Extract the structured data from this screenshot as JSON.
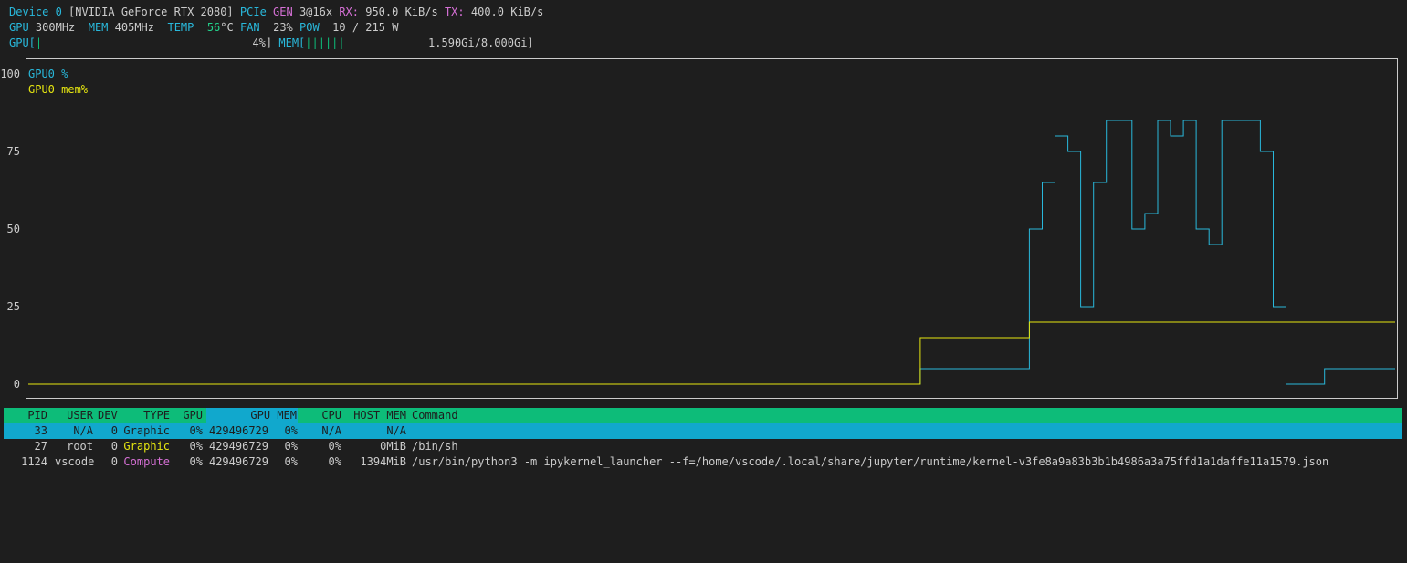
{
  "status": {
    "device_label": "Device 0",
    "device_name": "[NVIDIA GeForce RTX 2080]",
    "pcie_label": "PCIe",
    "gen_label": "GEN",
    "gen_value": "3@16x",
    "rx_label": "RX:",
    "rx_value": "950.0 KiB/s",
    "tx_label": "TX:",
    "tx_value": "400.0 KiB/s",
    "gpu_label": "GPU",
    "gpu_clock": "300MHz",
    "mem_label": "MEM",
    "mem_clock": "405MHz",
    "temp_label": "TEMP",
    "temp_value": "56",
    "temp_unit": "°C",
    "fan_label": "FAN",
    "fan_value": "23%",
    "pow_label": "POW",
    "pow_value": "10 / 215 W",
    "gpu_bar_label": "GPU[",
    "gpu_bar_fill": "|",
    "gpu_bar_value": "4%]",
    "mem_bar_label": "MEM[",
    "mem_bar_fill": "||||||",
    "mem_bar_value": "1.590Gi/8.000Gi]"
  },
  "chart_data": {
    "type": "line",
    "ylim": [
      0,
      100
    ],
    "yticks": [
      "100",
      "75",
      "50",
      "25",
      "0"
    ],
    "legend": [
      "GPU0 %",
      "GPU0 mem%"
    ],
    "colors": {
      "gpu": "#29b8db",
      "mem": "#e5e510"
    },
    "series": [
      {
        "name": "GPU0 %",
        "values": [
          0,
          0,
          0,
          0,
          0,
          0,
          0,
          0,
          0,
          0,
          0,
          0,
          0,
          0,
          0,
          0,
          0,
          0,
          0,
          0,
          0,
          0,
          0,
          0,
          0,
          0,
          0,
          0,
          0,
          0,
          0,
          0,
          0,
          0,
          0,
          0,
          0,
          0,
          0,
          0,
          0,
          0,
          0,
          0,
          0,
          0,
          0,
          0,
          0,
          0,
          0,
          0,
          0,
          0,
          0,
          0,
          0,
          0,
          0,
          0,
          0,
          0,
          0,
          0,
          0,
          0,
          0,
          0,
          0,
          0,
          0,
          0,
          0,
          0,
          0,
          0,
          0,
          0,
          0,
          0,
          0,
          0,
          0,
          0,
          0,
          0,
          0,
          0,
          0,
          0,
          0,
          0,
          0,
          0,
          0,
          0,
          0,
          0,
          0,
          0,
          0,
          0,
          0,
          0,
          0,
          0,
          0,
          0,
          0,
          0,
          0,
          0,
          0,
          0,
          0,
          0,
          0,
          0,
          0,
          0,
          0,
          0,
          0,
          0,
          0,
          0,
          0,
          0,
          0,
          0,
          0,
          0,
          0,
          0,
          0,
          0,
          0,
          0,
          0,
          5,
          5,
          5,
          5,
          5,
          5,
          5,
          5,
          5,
          5,
          5,
          5,
          5,
          5,
          5,
          5,
          5,
          50,
          50,
          65,
          65,
          80,
          80,
          75,
          75,
          25,
          25,
          65,
          65,
          85,
          85,
          85,
          85,
          50,
          50,
          55,
          55,
          85,
          85,
          80,
          80,
          85,
          85,
          50,
          50,
          45,
          45,
          85,
          85,
          85,
          85,
          85,
          85,
          75,
          75,
          25,
          25,
          0,
          0,
          0,
          0,
          0,
          0,
          5,
          5,
          5,
          5,
          5,
          5,
          5,
          5,
          5,
          5,
          5
        ]
      },
      {
        "name": "GPU0 mem%",
        "values": [
          0,
          0,
          0,
          0,
          0,
          0,
          0,
          0,
          0,
          0,
          0,
          0,
          0,
          0,
          0,
          0,
          0,
          0,
          0,
          0,
          0,
          0,
          0,
          0,
          0,
          0,
          0,
          0,
          0,
          0,
          0,
          0,
          0,
          0,
          0,
          0,
          0,
          0,
          0,
          0,
          0,
          0,
          0,
          0,
          0,
          0,
          0,
          0,
          0,
          0,
          0,
          0,
          0,
          0,
          0,
          0,
          0,
          0,
          0,
          0,
          0,
          0,
          0,
          0,
          0,
          0,
          0,
          0,
          0,
          0,
          0,
          0,
          0,
          0,
          0,
          0,
          0,
          0,
          0,
          0,
          0,
          0,
          0,
          0,
          0,
          0,
          0,
          0,
          0,
          0,
          0,
          0,
          0,
          0,
          0,
          0,
          0,
          0,
          0,
          0,
          0,
          0,
          0,
          0,
          0,
          0,
          0,
          0,
          0,
          0,
          0,
          0,
          0,
          0,
          0,
          0,
          0,
          0,
          0,
          0,
          0,
          0,
          0,
          0,
          0,
          0,
          0,
          0,
          0,
          0,
          0,
          0,
          0,
          0,
          0,
          0,
          0,
          0,
          0,
          15,
          15,
          15,
          15,
          15,
          15,
          15,
          15,
          15,
          15,
          15,
          15,
          15,
          15,
          15,
          15,
          15,
          20,
          20,
          20,
          20,
          20,
          20,
          20,
          20,
          20,
          20,
          20,
          20,
          20,
          20,
          20,
          20,
          20,
          20,
          20,
          20,
          20,
          20,
          20,
          20,
          20,
          20,
          20,
          20,
          20,
          20,
          20,
          20,
          20,
          20,
          20,
          20,
          20,
          20,
          20,
          20,
          20,
          20,
          20,
          20,
          20,
          20,
          20,
          20,
          20,
          20,
          20,
          20,
          20,
          20,
          20,
          20,
          20
        ]
      }
    ]
  },
  "processes": {
    "headers": [
      "PID",
      "USER",
      "DEV",
      "TYPE",
      "GPU",
      "GPU MEM",
      "CPU",
      "HOST MEM",
      "Command"
    ],
    "rows": [
      {
        "pid": "33",
        "user": "N/A",
        "dev": "0",
        "type": "Graphic",
        "gpu": "0%",
        "gpu_mem": "429496729",
        "gpu_mem_pct": "0%",
        "cpu": "N/A",
        "host_mem": "N/A",
        "command": ""
      },
      {
        "pid": "27",
        "user": "root",
        "dev": "0",
        "type": "Graphic",
        "gpu": "0%",
        "gpu_mem": "429496729",
        "gpu_mem_pct": "0%",
        "cpu": "0%",
        "host_mem": "0MiB",
        "command": "/bin/sh"
      },
      {
        "pid": "1124",
        "user": "vscode",
        "dev": "0",
        "type": "Compute",
        "gpu": "0%",
        "gpu_mem": "429496729",
        "gpu_mem_pct": "0%",
        "cpu": "0%",
        "host_mem": "1394MiB",
        "command": "/usr/bin/python3 -m ipykernel_launcher --f=/home/vscode/.local/share/jupyter/runtime/kernel-v3fe8a9a83b3b1b4986a3a75ffd1a1daffe11a1579.json"
      }
    ]
  }
}
